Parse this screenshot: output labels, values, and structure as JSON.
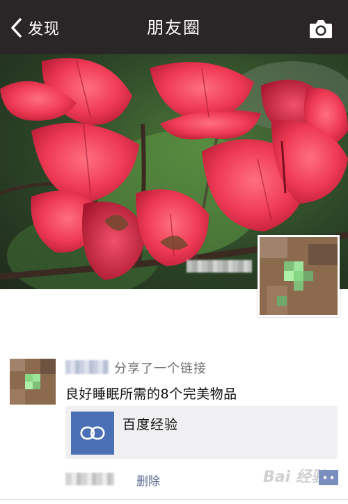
{
  "navbar": {
    "back_label": "发现",
    "title": "朋友圈"
  },
  "post": {
    "shared_text": "分享了一个链接",
    "content": "良好睡眠所需的8个完美物品",
    "link": {
      "title": "百度经验"
    },
    "delete_label": "删除"
  },
  "watermark": "Bai 经验",
  "colors": {
    "navbar_bg": "#2a2527",
    "link_blue": "#5b6b91",
    "link_icon_bg": "#4a6fb5",
    "card_bg": "#f0f0f2"
  }
}
